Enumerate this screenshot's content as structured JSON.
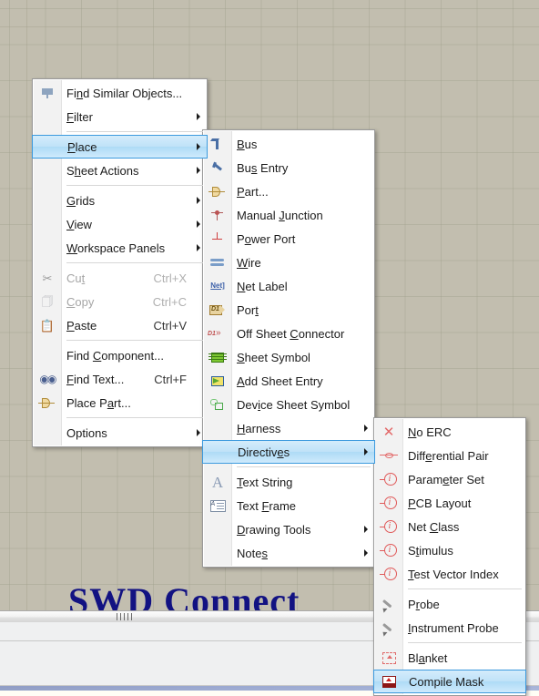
{
  "canvas": {
    "sheet_title": "SWD Connect",
    "background_color": "#fffdf6",
    "grid_color": "#969682"
  },
  "selection_color": "#bfe2f8",
  "selection_border_color": "#3c9ade",
  "menus": {
    "main": {
      "name": "right-click-context-menu",
      "items": [
        {
          "label": "Find Similar Objects...",
          "icon": "filter-funnel-icon",
          "accel": "",
          "arrow": false,
          "selected": false,
          "disabled": false,
          "sep_after": false
        },
        {
          "label": "Filter",
          "icon": "",
          "accel": "",
          "arrow": true,
          "selected": false,
          "disabled": false,
          "sep_after": true
        },
        {
          "label": "Place",
          "icon": "",
          "accel": "",
          "arrow": true,
          "selected": true,
          "disabled": false,
          "sep_after": false
        },
        {
          "label": "Sheet Actions",
          "icon": "",
          "accel": "",
          "arrow": true,
          "selected": false,
          "disabled": false,
          "sep_after": true
        },
        {
          "label": "Grids",
          "icon": "",
          "accel": "",
          "arrow": true,
          "selected": false,
          "disabled": false,
          "sep_after": false
        },
        {
          "label": "View",
          "icon": "",
          "accel": "",
          "arrow": true,
          "selected": false,
          "disabled": false,
          "sep_after": false
        },
        {
          "label": "Workspace Panels",
          "icon": "",
          "accel": "",
          "arrow": true,
          "selected": false,
          "disabled": false,
          "sep_after": true
        },
        {
          "label": "Cut",
          "icon": "scissors-icon",
          "accel": "Ctrl+X",
          "arrow": false,
          "selected": false,
          "disabled": true,
          "sep_after": false
        },
        {
          "label": "Copy",
          "icon": "copy-icon",
          "accel": "Ctrl+C",
          "arrow": false,
          "selected": false,
          "disabled": true,
          "sep_after": false
        },
        {
          "label": "Paste",
          "icon": "paste-icon",
          "accel": "Ctrl+V",
          "arrow": false,
          "selected": false,
          "disabled": false,
          "sep_after": true
        },
        {
          "label": "Find Component...",
          "icon": "",
          "accel": "",
          "arrow": false,
          "selected": false,
          "disabled": false,
          "sep_after": false
        },
        {
          "label": "Find Text...",
          "icon": "binoculars-icon",
          "accel": "Ctrl+F",
          "arrow": false,
          "selected": false,
          "disabled": false,
          "sep_after": false
        },
        {
          "label": "Place Part...",
          "icon": "part-icon",
          "accel": "",
          "arrow": false,
          "selected": false,
          "disabled": false,
          "sep_after": true
        },
        {
          "label": "Options",
          "icon": "",
          "accel": "",
          "arrow": true,
          "selected": false,
          "disabled": false,
          "sep_after": false
        }
      ]
    },
    "place": {
      "name": "place-submenu",
      "items": [
        {
          "label": "Bus",
          "icon": "bus-icon",
          "arrow": false,
          "selected": false,
          "sep_after": false
        },
        {
          "label": "Bus Entry",
          "icon": "bus-entry-icon",
          "arrow": false,
          "selected": false,
          "sep_after": false
        },
        {
          "label": "Part...",
          "icon": "part-icon",
          "arrow": false,
          "selected": false,
          "sep_after": false
        },
        {
          "label": "Manual Junction",
          "icon": "junction-icon",
          "arrow": false,
          "selected": false,
          "sep_after": false
        },
        {
          "label": "Power Port",
          "icon": "power-port-icon",
          "arrow": false,
          "selected": false,
          "sep_after": false
        },
        {
          "label": "Wire",
          "icon": "wire-icon",
          "arrow": false,
          "selected": false,
          "sep_after": false
        },
        {
          "label": "Net Label",
          "icon": "net-label-icon",
          "arrow": false,
          "selected": false,
          "sep_after": false
        },
        {
          "label": "Port",
          "icon": "port-icon",
          "arrow": false,
          "selected": false,
          "sep_after": false
        },
        {
          "label": "Off Sheet Connector",
          "icon": "off-sheet-connector-icon",
          "arrow": false,
          "selected": false,
          "sep_after": false
        },
        {
          "label": "Sheet Symbol",
          "icon": "sheet-symbol-icon",
          "arrow": false,
          "selected": false,
          "sep_after": false
        },
        {
          "label": "Add Sheet Entry",
          "icon": "add-sheet-entry-icon",
          "arrow": false,
          "selected": false,
          "sep_after": false
        },
        {
          "label": "Device Sheet Symbol",
          "icon": "device-sheet-symbol-icon",
          "arrow": false,
          "selected": false,
          "sep_after": false
        },
        {
          "label": "Harness",
          "icon": "",
          "arrow": true,
          "selected": false,
          "sep_after": false
        },
        {
          "label": "Directives",
          "icon": "",
          "arrow": true,
          "selected": true,
          "sep_after": true
        },
        {
          "label": "Text String",
          "icon": "text-string-icon",
          "arrow": false,
          "selected": false,
          "sep_after": false
        },
        {
          "label": "Text Frame",
          "icon": "text-frame-icon",
          "arrow": false,
          "selected": false,
          "sep_after": false
        },
        {
          "label": "Drawing Tools",
          "icon": "",
          "arrow": true,
          "selected": false,
          "sep_after": false
        },
        {
          "label": "Notes",
          "icon": "",
          "arrow": true,
          "selected": false,
          "sep_after": false
        }
      ]
    },
    "directives": {
      "name": "directives-submenu",
      "items": [
        {
          "label": "No ERC",
          "icon": "no-erc-cross-icon",
          "arrow": false,
          "selected": false,
          "sep_after": false
        },
        {
          "label": "Differential Pair",
          "icon": "differential-pair-icon",
          "arrow": false,
          "selected": false,
          "sep_after": false
        },
        {
          "label": "Parameter Set",
          "icon": "directive-info-icon",
          "arrow": false,
          "selected": false,
          "sep_after": false
        },
        {
          "label": "PCB Layout",
          "icon": "directive-info-icon",
          "arrow": false,
          "selected": false,
          "sep_after": false
        },
        {
          "label": "Net Class",
          "icon": "directive-info-icon",
          "arrow": false,
          "selected": false,
          "sep_after": false
        },
        {
          "label": "Stimulus",
          "icon": "directive-info-icon",
          "arrow": false,
          "selected": false,
          "sep_after": false
        },
        {
          "label": "Test Vector Index",
          "icon": "directive-info-icon",
          "arrow": false,
          "selected": false,
          "sep_after": true
        },
        {
          "label": "Probe",
          "icon": "probe-icon",
          "arrow": false,
          "selected": false,
          "sep_after": false
        },
        {
          "label": "Instrument Probe",
          "icon": "probe-icon",
          "arrow": false,
          "selected": false,
          "sep_after": true
        },
        {
          "label": "Blanket",
          "icon": "blanket-icon",
          "arrow": false,
          "selected": false,
          "sep_after": false
        },
        {
          "label": "Compile Mask",
          "icon": "compile-mask-icon",
          "arrow": false,
          "selected": true,
          "sep_after": false
        }
      ]
    }
  }
}
